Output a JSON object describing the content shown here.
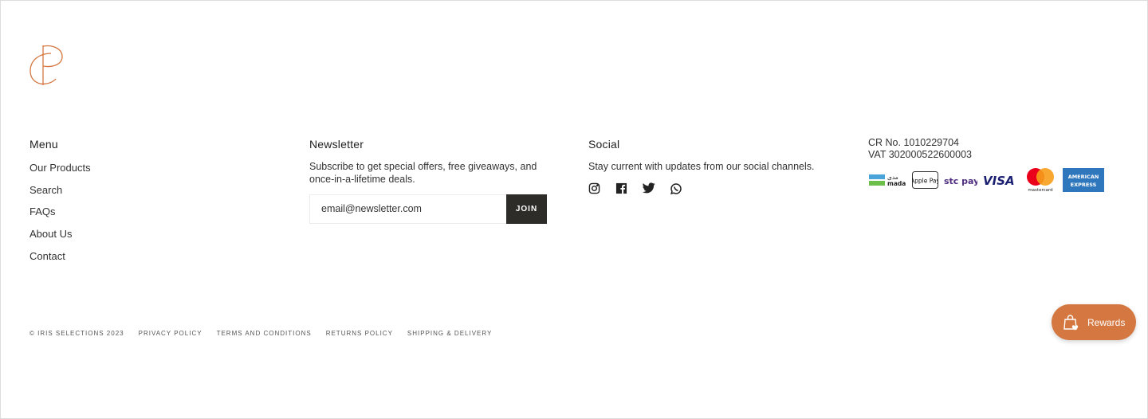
{
  "brand": {
    "logo_icon": "iris-selections-monogram-icon",
    "accent": "#d57740"
  },
  "menu": {
    "title": "Menu",
    "items": [
      "Our Products",
      "Search",
      "FAQs",
      "About Us",
      "Contact"
    ]
  },
  "newsletter": {
    "title": "Newsletter",
    "text": "Subscribe to get special offers, free giveaways, and once-in-a-lifetime deals.",
    "email_value": "email@newsletter.com",
    "join_label": "JOIN"
  },
  "social": {
    "title": "Social",
    "text": "Stay current with updates from our social channels.",
    "icons": [
      "instagram-icon",
      "facebook-icon",
      "twitter-icon",
      "whatsapp-icon"
    ]
  },
  "legal": {
    "cr": "CR No. 1010229704",
    "vat": "VAT 302000522600003",
    "payments": [
      "mada",
      "Apple Pay",
      "stc pay",
      "VISA",
      "mastercard",
      "American Express"
    ]
  },
  "footer_links": {
    "copyright": "© IRIS SELECTIONS 2023",
    "privacy": "PRIVACY POLICY",
    "terms": "TERMS AND CONDITIONS",
    "returns": "RETURNS POLICY",
    "shipping": "SHIPPING & DELIVERY"
  },
  "rewards": {
    "label": "Rewards",
    "color": "#d57740"
  }
}
